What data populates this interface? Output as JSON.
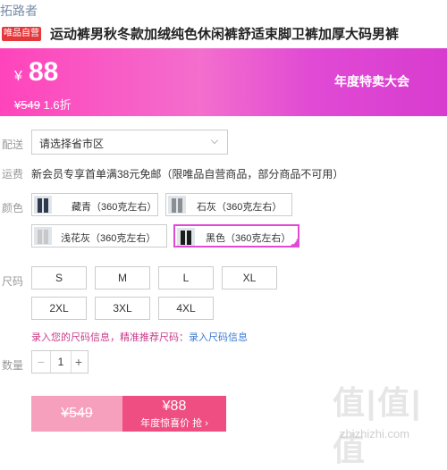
{
  "header": {
    "brand": "拓路者",
    "tag": "唯品自营",
    "title": "运动裤男秋冬款加绒纯色休闲裤舒适束脚卫裤加厚大码男裤"
  },
  "price": {
    "currency": "¥",
    "current": "88",
    "original": "¥549",
    "discount": "1.6折",
    "event": "年度特卖大会"
  },
  "delivery": {
    "label": "配送",
    "placeholder": "请选择省市区"
  },
  "shipping": {
    "label": "运费",
    "text": "新会员专享首单满38元免邮（限唯品自营商品，部分商品不可用）"
  },
  "colors": {
    "label": "颜色",
    "options": [
      {
        "name": "藏青（360克左右）",
        "swatch": "#2f3a4c"
      },
      {
        "name": "石灰（360克左右）",
        "swatch": "#8c8f92"
      },
      {
        "name": "浅花灰（360克左右）",
        "swatch": "#c8c8c8"
      },
      {
        "name": "黑色（360克左右）",
        "swatch": "#1c1c1c"
      }
    ],
    "selected": "黑色（360克左右）"
  },
  "sizes": {
    "label": "尺码",
    "options": [
      "S",
      "M",
      "L",
      "XL",
      "2XL",
      "3XL",
      "4XL"
    ]
  },
  "size_tip": {
    "prompt": "录入您的尺码信息，精准推荐尺码：",
    "link": "录入尺码信息"
  },
  "quantity": {
    "label": "数量",
    "minus": "−",
    "value": "1",
    "plus": "+"
  },
  "buy": {
    "original": "¥549",
    "price": "¥88",
    "cta": "年度惊喜价 抢 ›"
  },
  "watermark": {
    "logo": "值|值|值",
    "url": "zhizhizhi.com"
  },
  "colors_theme": {
    "accent": "#e04ad4",
    "banner": "#f36ecd",
    "buy": "#ee4e82"
  }
}
